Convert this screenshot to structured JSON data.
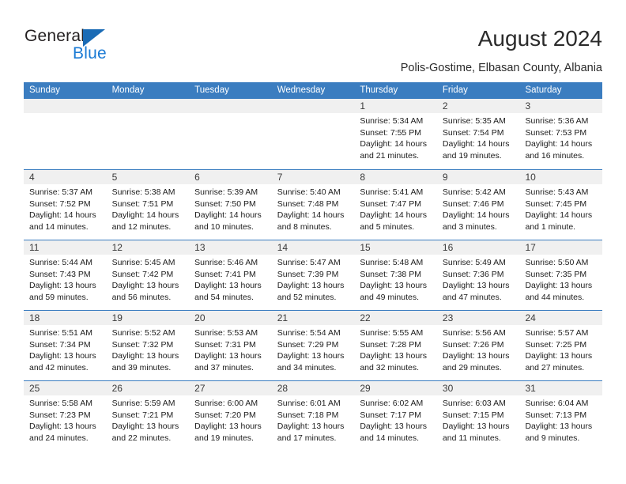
{
  "brand": {
    "name_top": "General",
    "name_bottom": "Blue",
    "triangle_color": "#1a6bb5",
    "blue_text_color": "#1a7ad4"
  },
  "header": {
    "title": "August 2024",
    "location": "Polis-Gostime, Elbasan County, Albania"
  },
  "theme": {
    "header_blue": "#3b7dc0",
    "day_band_gray": "#f0f0f0",
    "text_color": "#1c1c1c"
  },
  "weekdays": [
    "Sunday",
    "Monday",
    "Tuesday",
    "Wednesday",
    "Thursday",
    "Friday",
    "Saturday"
  ],
  "weeks": [
    [
      {
        "day": "",
        "empty": true
      },
      {
        "day": "",
        "empty": true
      },
      {
        "day": "",
        "empty": true
      },
      {
        "day": "",
        "empty": true
      },
      {
        "day": "1",
        "sunrise": "Sunrise: 5:34 AM",
        "sunset": "Sunset: 7:55 PM",
        "daylight_line1": "Daylight: 14 hours",
        "daylight_line2": "and 21 minutes."
      },
      {
        "day": "2",
        "sunrise": "Sunrise: 5:35 AM",
        "sunset": "Sunset: 7:54 PM",
        "daylight_line1": "Daylight: 14 hours",
        "daylight_line2": "and 19 minutes."
      },
      {
        "day": "3",
        "sunrise": "Sunrise: 5:36 AM",
        "sunset": "Sunset: 7:53 PM",
        "daylight_line1": "Daylight: 14 hours",
        "daylight_line2": "and 16 minutes."
      }
    ],
    [
      {
        "day": "4",
        "sunrise": "Sunrise: 5:37 AM",
        "sunset": "Sunset: 7:52 PM",
        "daylight_line1": "Daylight: 14 hours",
        "daylight_line2": "and 14 minutes."
      },
      {
        "day": "5",
        "sunrise": "Sunrise: 5:38 AM",
        "sunset": "Sunset: 7:51 PM",
        "daylight_line1": "Daylight: 14 hours",
        "daylight_line2": "and 12 minutes."
      },
      {
        "day": "6",
        "sunrise": "Sunrise: 5:39 AM",
        "sunset": "Sunset: 7:50 PM",
        "daylight_line1": "Daylight: 14 hours",
        "daylight_line2": "and 10 minutes."
      },
      {
        "day": "7",
        "sunrise": "Sunrise: 5:40 AM",
        "sunset": "Sunset: 7:48 PM",
        "daylight_line1": "Daylight: 14 hours",
        "daylight_line2": "and 8 minutes."
      },
      {
        "day": "8",
        "sunrise": "Sunrise: 5:41 AM",
        "sunset": "Sunset: 7:47 PM",
        "daylight_line1": "Daylight: 14 hours",
        "daylight_line2": "and 5 minutes."
      },
      {
        "day": "9",
        "sunrise": "Sunrise: 5:42 AM",
        "sunset": "Sunset: 7:46 PM",
        "daylight_line1": "Daylight: 14 hours",
        "daylight_line2": "and 3 minutes."
      },
      {
        "day": "10",
        "sunrise": "Sunrise: 5:43 AM",
        "sunset": "Sunset: 7:45 PM",
        "daylight_line1": "Daylight: 14 hours",
        "daylight_line2": "and 1 minute."
      }
    ],
    [
      {
        "day": "11",
        "sunrise": "Sunrise: 5:44 AM",
        "sunset": "Sunset: 7:43 PM",
        "daylight_line1": "Daylight: 13 hours",
        "daylight_line2": "and 59 minutes."
      },
      {
        "day": "12",
        "sunrise": "Sunrise: 5:45 AM",
        "sunset": "Sunset: 7:42 PM",
        "daylight_line1": "Daylight: 13 hours",
        "daylight_line2": "and 56 minutes."
      },
      {
        "day": "13",
        "sunrise": "Sunrise: 5:46 AM",
        "sunset": "Sunset: 7:41 PM",
        "daylight_line1": "Daylight: 13 hours",
        "daylight_line2": "and 54 minutes."
      },
      {
        "day": "14",
        "sunrise": "Sunrise: 5:47 AM",
        "sunset": "Sunset: 7:39 PM",
        "daylight_line1": "Daylight: 13 hours",
        "daylight_line2": "and 52 minutes."
      },
      {
        "day": "15",
        "sunrise": "Sunrise: 5:48 AM",
        "sunset": "Sunset: 7:38 PM",
        "daylight_line1": "Daylight: 13 hours",
        "daylight_line2": "and 49 minutes."
      },
      {
        "day": "16",
        "sunrise": "Sunrise: 5:49 AM",
        "sunset": "Sunset: 7:36 PM",
        "daylight_line1": "Daylight: 13 hours",
        "daylight_line2": "and 47 minutes."
      },
      {
        "day": "17",
        "sunrise": "Sunrise: 5:50 AM",
        "sunset": "Sunset: 7:35 PM",
        "daylight_line1": "Daylight: 13 hours",
        "daylight_line2": "and 44 minutes."
      }
    ],
    [
      {
        "day": "18",
        "sunrise": "Sunrise: 5:51 AM",
        "sunset": "Sunset: 7:34 PM",
        "daylight_line1": "Daylight: 13 hours",
        "daylight_line2": "and 42 minutes."
      },
      {
        "day": "19",
        "sunrise": "Sunrise: 5:52 AM",
        "sunset": "Sunset: 7:32 PM",
        "daylight_line1": "Daylight: 13 hours",
        "daylight_line2": "and 39 minutes."
      },
      {
        "day": "20",
        "sunrise": "Sunrise: 5:53 AM",
        "sunset": "Sunset: 7:31 PM",
        "daylight_line1": "Daylight: 13 hours",
        "daylight_line2": "and 37 minutes."
      },
      {
        "day": "21",
        "sunrise": "Sunrise: 5:54 AM",
        "sunset": "Sunset: 7:29 PM",
        "daylight_line1": "Daylight: 13 hours",
        "daylight_line2": "and 34 minutes."
      },
      {
        "day": "22",
        "sunrise": "Sunrise: 5:55 AM",
        "sunset": "Sunset: 7:28 PM",
        "daylight_line1": "Daylight: 13 hours",
        "daylight_line2": "and 32 minutes."
      },
      {
        "day": "23",
        "sunrise": "Sunrise: 5:56 AM",
        "sunset": "Sunset: 7:26 PM",
        "daylight_line1": "Daylight: 13 hours",
        "daylight_line2": "and 29 minutes."
      },
      {
        "day": "24",
        "sunrise": "Sunrise: 5:57 AM",
        "sunset": "Sunset: 7:25 PM",
        "daylight_line1": "Daylight: 13 hours",
        "daylight_line2": "and 27 minutes."
      }
    ],
    [
      {
        "day": "25",
        "sunrise": "Sunrise: 5:58 AM",
        "sunset": "Sunset: 7:23 PM",
        "daylight_line1": "Daylight: 13 hours",
        "daylight_line2": "and 24 minutes."
      },
      {
        "day": "26",
        "sunrise": "Sunrise: 5:59 AM",
        "sunset": "Sunset: 7:21 PM",
        "daylight_line1": "Daylight: 13 hours",
        "daylight_line2": "and 22 minutes."
      },
      {
        "day": "27",
        "sunrise": "Sunrise: 6:00 AM",
        "sunset": "Sunset: 7:20 PM",
        "daylight_line1": "Daylight: 13 hours",
        "daylight_line2": "and 19 minutes."
      },
      {
        "day": "28",
        "sunrise": "Sunrise: 6:01 AM",
        "sunset": "Sunset: 7:18 PM",
        "daylight_line1": "Daylight: 13 hours",
        "daylight_line2": "and 17 minutes."
      },
      {
        "day": "29",
        "sunrise": "Sunrise: 6:02 AM",
        "sunset": "Sunset: 7:17 PM",
        "daylight_line1": "Daylight: 13 hours",
        "daylight_line2": "and 14 minutes."
      },
      {
        "day": "30",
        "sunrise": "Sunrise: 6:03 AM",
        "sunset": "Sunset: 7:15 PM",
        "daylight_line1": "Daylight: 13 hours",
        "daylight_line2": "and 11 minutes."
      },
      {
        "day": "31",
        "sunrise": "Sunrise: 6:04 AM",
        "sunset": "Sunset: 7:13 PM",
        "daylight_line1": "Daylight: 13 hours",
        "daylight_line2": "and 9 minutes."
      }
    ]
  ]
}
